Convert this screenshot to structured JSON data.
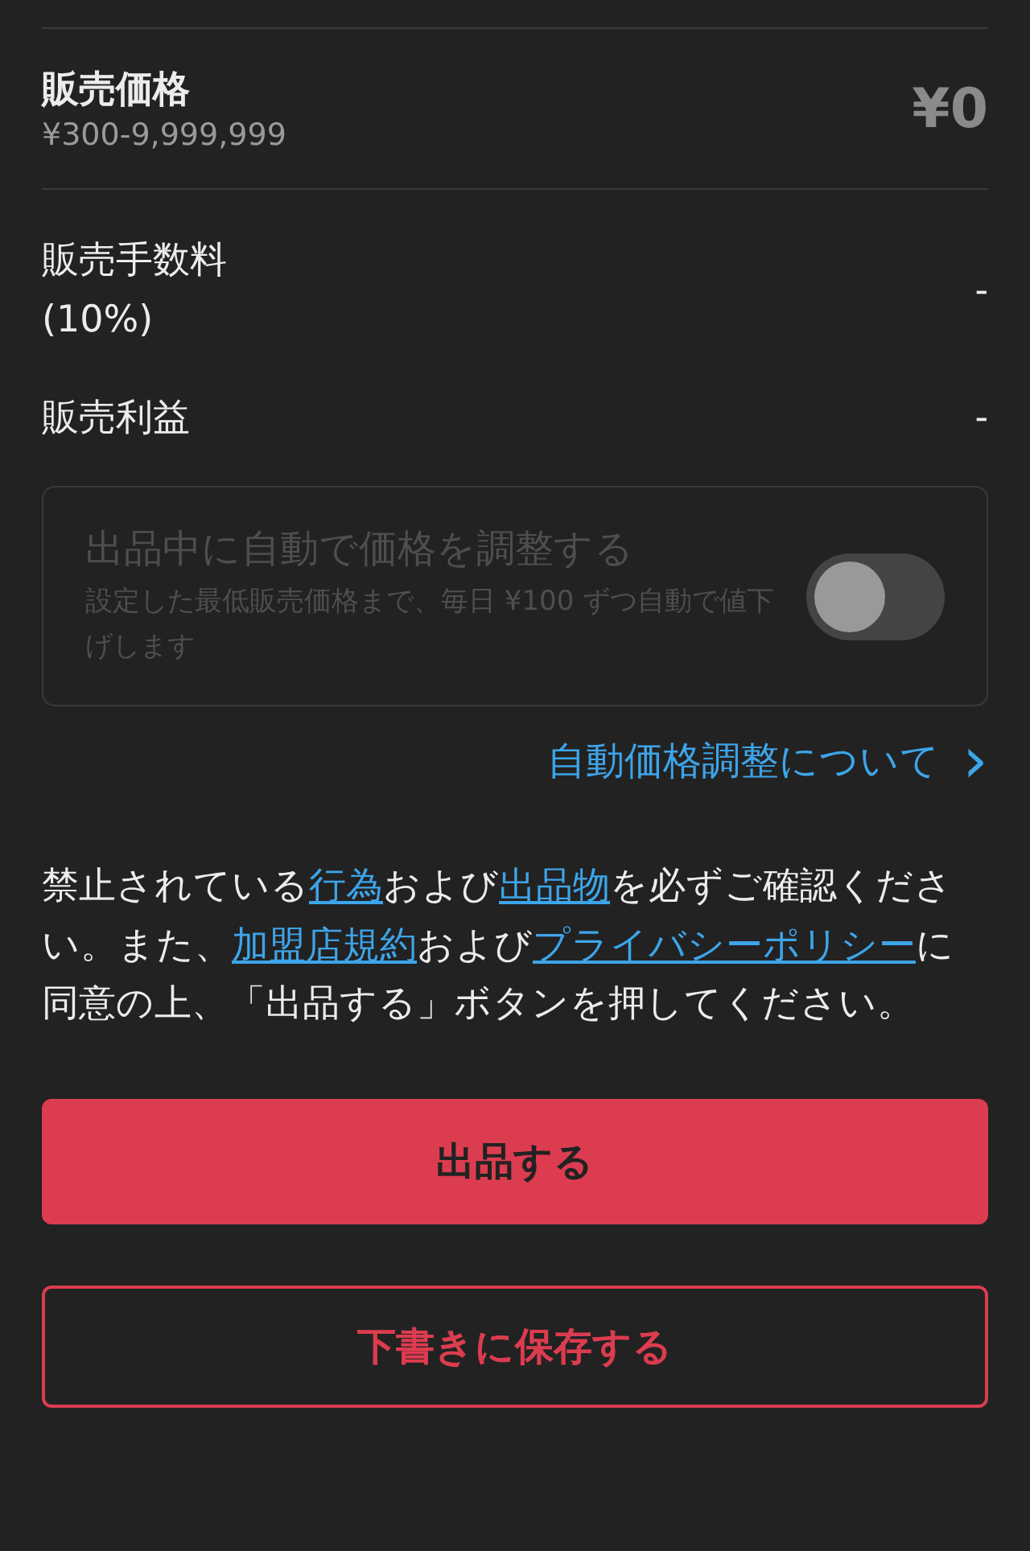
{
  "price": {
    "label": "販売価格",
    "range": "¥300-9,999,999",
    "value": "¥0"
  },
  "fee": {
    "label": "販売手数料\n(10%)",
    "value": "-"
  },
  "profit": {
    "label": "販売利益",
    "value": "-"
  },
  "auto_adjust": {
    "title": "出品中に自動で価格を調整する",
    "description": "設定した最低販売価格まで、毎日 ¥100 ずつ自動で値下げします",
    "disabled": true,
    "on": false
  },
  "about_link": {
    "label": "自動価格調整について",
    "icon": "›"
  },
  "notice": [
    {
      "kind": "text",
      "text": "禁止されている"
    },
    {
      "kind": "link",
      "text": "行為"
    },
    {
      "kind": "text",
      "text": "および"
    },
    {
      "kind": "link",
      "text": "出品物"
    },
    {
      "kind": "text",
      "text": "を必ずご確認ください。また、"
    },
    {
      "kind": "link",
      "text": "加盟店規約"
    },
    {
      "kind": "text",
      "text": "および"
    },
    {
      "kind": "link",
      "text": "プライバシーポリシー"
    },
    {
      "kind": "text",
      "text": "に同意の上、「出品する」ボタンを押してください。"
    }
  ],
  "buttons": [
    {
      "kind": "primary",
      "label": "出品する"
    },
    {
      "kind": "outline",
      "label": "下書きに保存する"
    }
  ]
}
